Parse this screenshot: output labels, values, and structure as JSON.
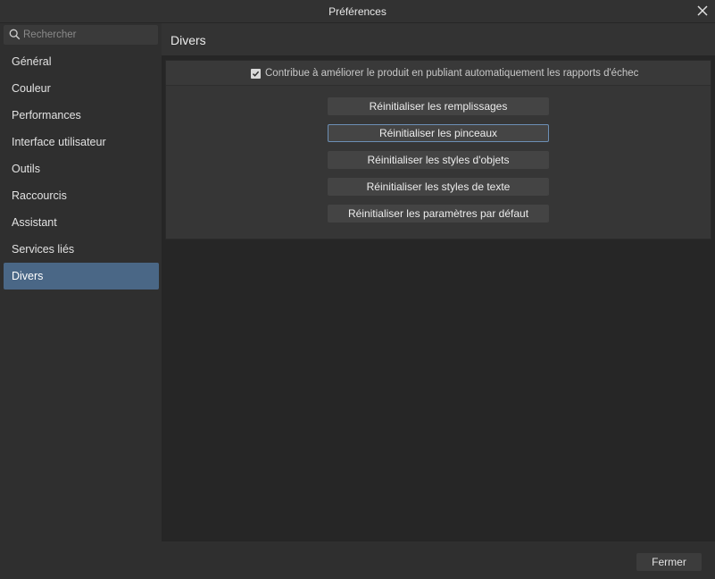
{
  "window": {
    "title": "Préférences"
  },
  "search": {
    "placeholder": "Rechercher"
  },
  "sidebar": {
    "items": [
      {
        "label": "Général"
      },
      {
        "label": "Couleur"
      },
      {
        "label": "Performances"
      },
      {
        "label": "Interface utilisateur"
      },
      {
        "label": "Outils"
      },
      {
        "label": "Raccourcis"
      },
      {
        "label": "Assistant"
      },
      {
        "label": "Services liés"
      },
      {
        "label": "Divers"
      }
    ],
    "active": "Divers"
  },
  "main": {
    "title": "Divers",
    "crash_report": {
      "label": "Contribue à améliorer le produit en publiant automatiquement les rapports d'échec",
      "checked": true
    },
    "buttons": [
      {
        "label": "Réinitialiser les remplissages"
      },
      {
        "label": "Réinitialiser les pinceaux"
      },
      {
        "label": "Réinitialiser les styles d'objets"
      },
      {
        "label": "Réinitialiser les styles de texte"
      },
      {
        "label": "Réinitialiser les paramètres par défaut"
      }
    ]
  },
  "footer": {
    "close_label": "Fermer"
  },
  "colors": {
    "accent": "#4a6786",
    "focus_border": "#6c8fb5"
  },
  "icons": {
    "search": "search-icon",
    "close": "close-icon",
    "check": "checkmark-icon"
  }
}
